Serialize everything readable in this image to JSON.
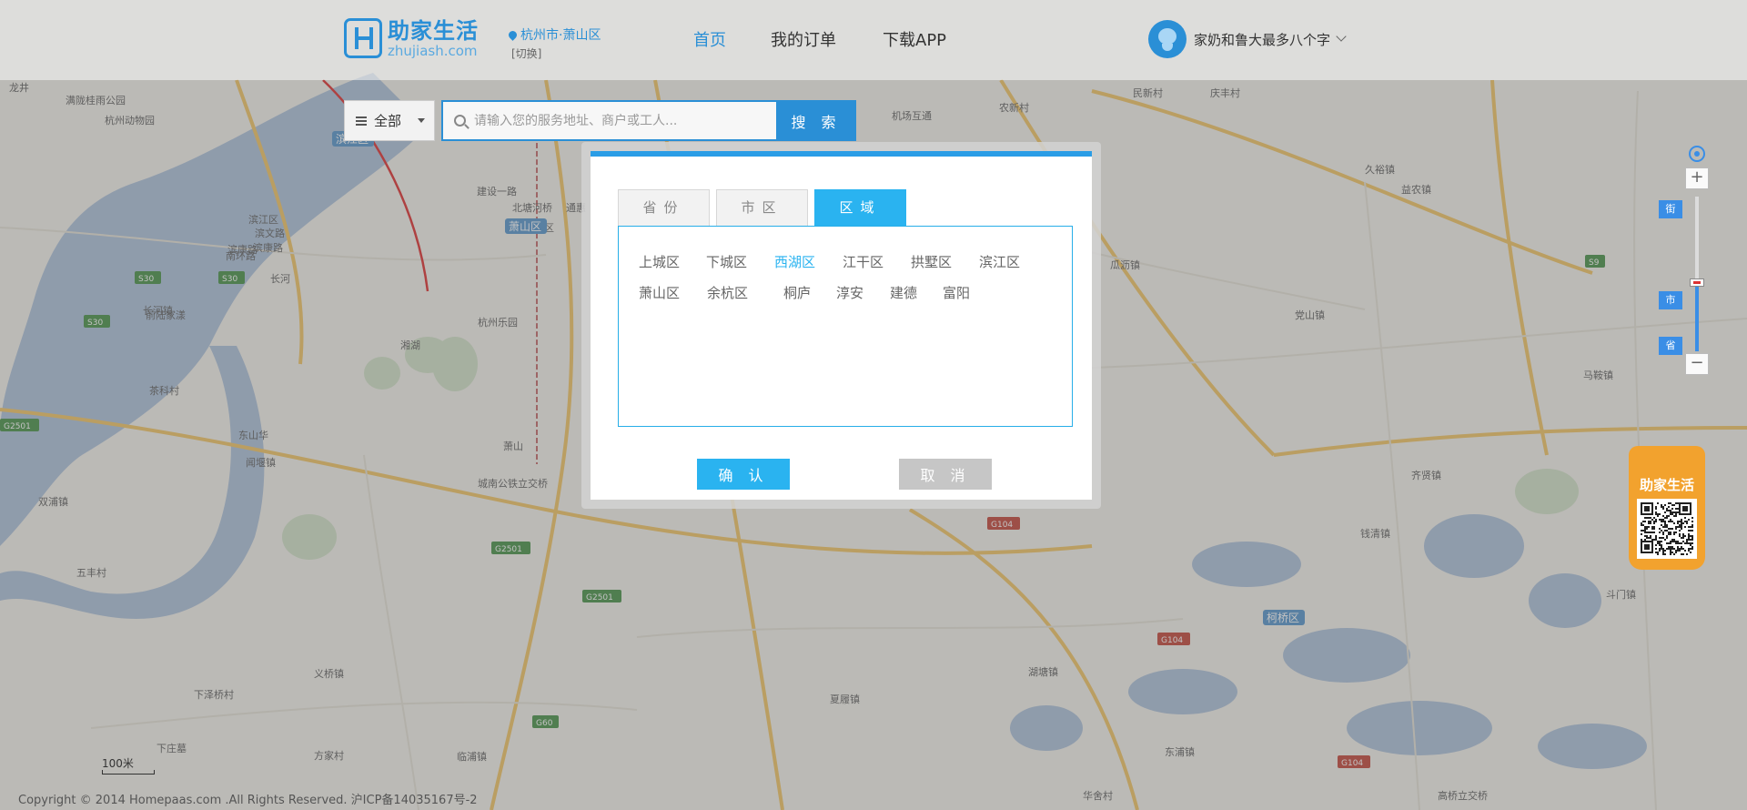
{
  "header": {
    "logo_cn": "助家生活",
    "logo_en": "zhujiash.com",
    "city": "杭州市·萧山区",
    "switch_label": "[切换]",
    "nav": [
      {
        "label": "首页",
        "active": true
      },
      {
        "label": "我的订单",
        "active": false
      },
      {
        "label": "下载APP",
        "active": false
      }
    ],
    "user_name": "家奶和鲁大最多八个字"
  },
  "search": {
    "category": "全部",
    "placeholder": "请输入您的服务地址、商户或工人...",
    "button_label": "搜 索"
  },
  "map": {
    "labels": [
      "龙井",
      "满陇桂雨公园",
      "杭州动物园",
      "滨江区",
      "滨文路",
      "滨康路",
      "滨康路",
      "南环路",
      "长河",
      "长河镇",
      "前陆家漾",
      "萧山区",
      "北塘河桥",
      "通惠",
      "建设一路",
      "杭州乐园",
      "湘湖",
      "萧山",
      "城南公铁立交桥",
      "闻堰镇",
      "东山华",
      "茶科村",
      "双浦镇",
      "五丰村",
      "义桥镇",
      "下泽桥村",
      "下庄墓",
      "方家村",
      "临浦镇",
      "机场互通",
      "农新村",
      "民新村",
      "庆丰村",
      "久裕镇",
      "益农镇",
      "瓜沥镇",
      "党山镇",
      "马鞍镇",
      "齐贤镇",
      "钱清镇",
      "柯桥区",
      "湖塘镇",
      "夏履镇",
      "东浦镇",
      "斗门镇",
      "华舍村",
      "高桥立交桥"
    ],
    "route_badges": [
      "S30",
      "S30",
      "S30",
      "G2501",
      "G2501",
      "G2501",
      "S9",
      "G104",
      "G104",
      "G104",
      "G60"
    ],
    "district_tags": [
      "滨江区",
      "萧山区",
      "柯桥区"
    ],
    "zoom_tags": [
      "街",
      "市",
      "省"
    ],
    "zoom_level_fraction": 0.45,
    "promo_title": "助家生活",
    "scale": "100米",
    "copyright": "Copyright © 2014 Homepaas.com .All Rights Reserved. 沪ICP备14035167号-2"
  },
  "modal": {
    "tabs": [
      {
        "label": "省份",
        "active": false
      },
      {
        "label": "市区",
        "active": false
      },
      {
        "label": "区域",
        "active": true
      }
    ],
    "regions": [
      "上城区",
      "下城区",
      "西湖区",
      "江干区",
      "拱墅区",
      "滨江区",
      "萧山区",
      "余杭区",
      "桐庐",
      "淳安",
      "建德",
      "富阳"
    ],
    "selected_region": "西湖区",
    "confirm_label": "确 认",
    "cancel_label": "取 消"
  },
  "colors": {
    "brand": "#2a8fd6",
    "accent": "#2ab3f0",
    "promo": "#f2a22e"
  }
}
